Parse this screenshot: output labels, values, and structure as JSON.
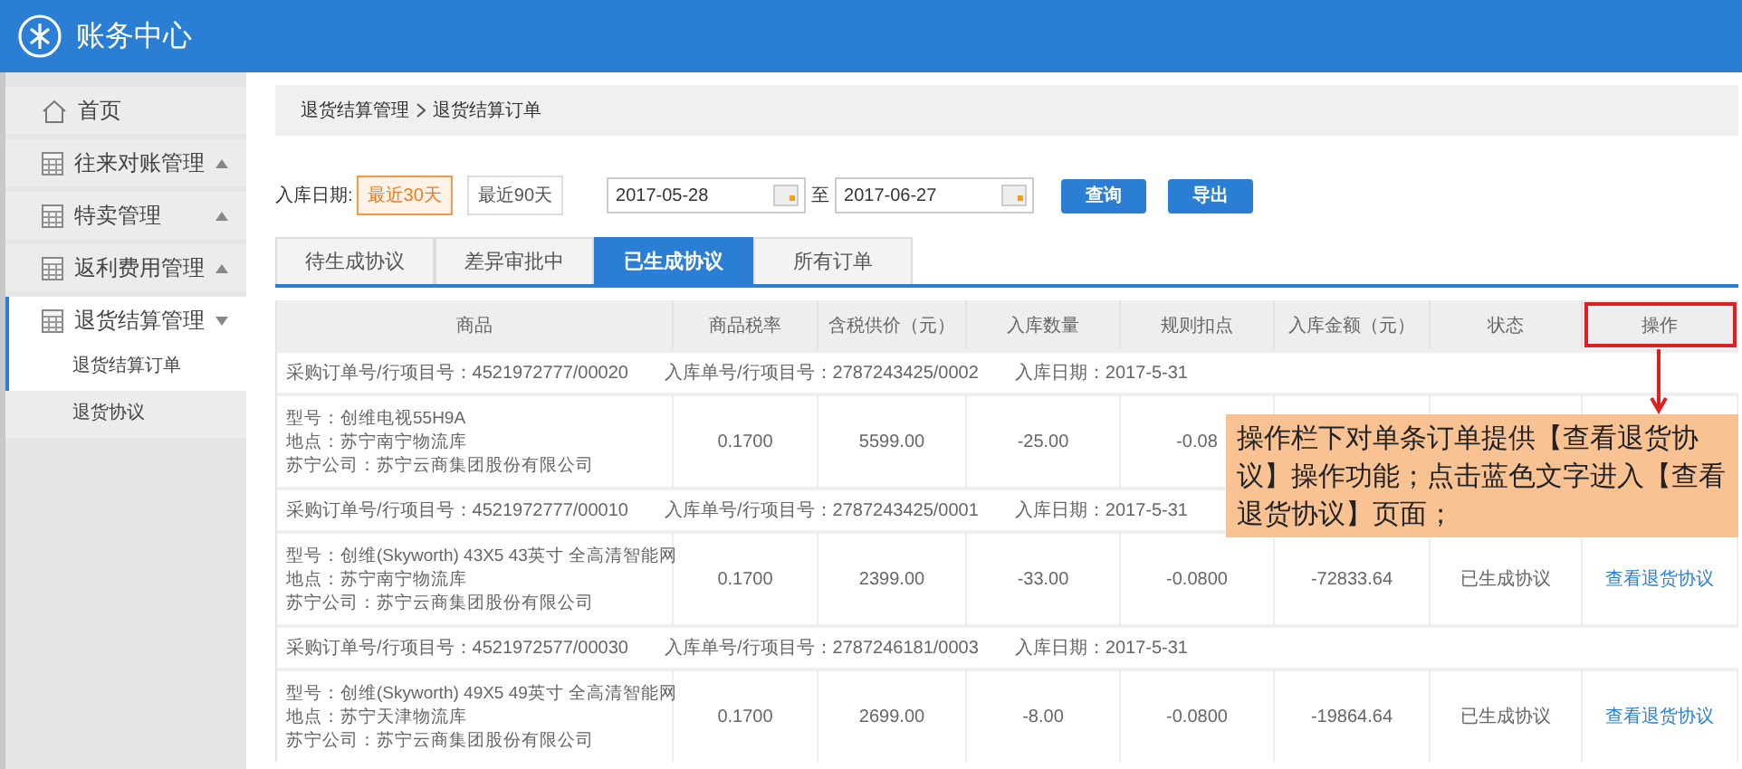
{
  "app": {
    "title": "账务中心"
  },
  "sidebar": {
    "items": [
      {
        "label": "首页",
        "kind": "home"
      },
      {
        "label": "往来对账管理",
        "kind": "group",
        "expanded": false
      },
      {
        "label": "特卖管理",
        "kind": "group",
        "expanded": false
      },
      {
        "label": "返利费用管理",
        "kind": "group",
        "expanded": false
      },
      {
        "label": "退货结算管理",
        "kind": "group",
        "expanded": true,
        "children": [
          {
            "label": "退货结算订单",
            "selected": true
          },
          {
            "label": "退货协议",
            "selected": false
          }
        ]
      }
    ]
  },
  "breadcrumb": [
    "退货结算管理",
    "退货结算订单"
  ],
  "filter": {
    "label": "入库日期:",
    "ranges": [
      {
        "label": "最近30天",
        "selected": true
      },
      {
        "label": "最近90天",
        "selected": false
      }
    ],
    "from": "2017-05-28",
    "separator": "至",
    "to": "2017-06-27",
    "buttons": [
      "查询",
      "导出"
    ]
  },
  "tabs": [
    {
      "label": "待生成协议",
      "selected": false
    },
    {
      "label": "差异审批中",
      "selected": false
    },
    {
      "label": "已生成协议",
      "selected": true
    },
    {
      "label": "所有订单",
      "selected": false
    }
  ],
  "table": {
    "columns": [
      {
        "label": "商品",
        "highlighted": false
      },
      {
        "label": "商品税率",
        "highlighted": false
      },
      {
        "label": "含税供价（元）",
        "highlighted": false
      },
      {
        "label": "入库数量",
        "highlighted": false
      },
      {
        "label": "规则扣点",
        "highlighted": false
      },
      {
        "label": "入库金额（元）",
        "highlighted": false
      },
      {
        "label": "状态",
        "highlighted": false
      },
      {
        "label": "操作",
        "highlighted": true
      }
    ],
    "orders": [
      {
        "po": "采购订单号/行项目号：4521972777/00020",
        "receipt": "入库单号/行项目号：2787243425/0002",
        "date": "入库日期：2017-5-31",
        "product": [
          "型号：创维电视55H9A",
          "地点：苏宁南宁物流库",
          "苏宁公司：苏宁云商集团股份有限公司"
        ],
        "tax": "0.1700",
        "price": "5599.00",
        "qty": "-25.00",
        "rule": "-0.08"
      },
      {
        "po": "采购订单号/行项目号：4521972777/00010",
        "receipt": "入库单号/行项目号：2787243425/0001",
        "date": "入库日期：2017-5-31",
        "product": [
          "型号：创维(Skyworth) 43X5 43英寸 全高清智能网",
          "地点：苏宁南宁物流库",
          "苏宁公司：苏宁云商集团股份有限公司"
        ],
        "tax": "0.1700",
        "price": "2399.00",
        "qty": "-33.00",
        "rule": "-0.0800",
        "amount": "-72833.64",
        "status": "已生成协议",
        "action": "查看退货协议"
      },
      {
        "po": "采购订单号/行项目号：4521972577/00030",
        "receipt": "入库单号/行项目号：2787246181/0003",
        "date": "入库日期：2017-5-31",
        "product": [
          "型号：创维(Skyworth) 49X5 49英寸 全高清智能网",
          "地点：苏宁天津物流库",
          "苏宁公司：苏宁云商集团股份有限公司"
        ],
        "tax": "0.1700",
        "price": "2699.00",
        "qty": "-8.00",
        "rule": "-0.0800",
        "amount": "-19864.64",
        "status": "已生成协议",
        "action": "查看退货协议"
      }
    ]
  },
  "annotation": {
    "text": "操作栏下对单条订单提供【查看退货协议】操作功能；点击蓝色文字进入【查看退货协议】页面；"
  }
}
